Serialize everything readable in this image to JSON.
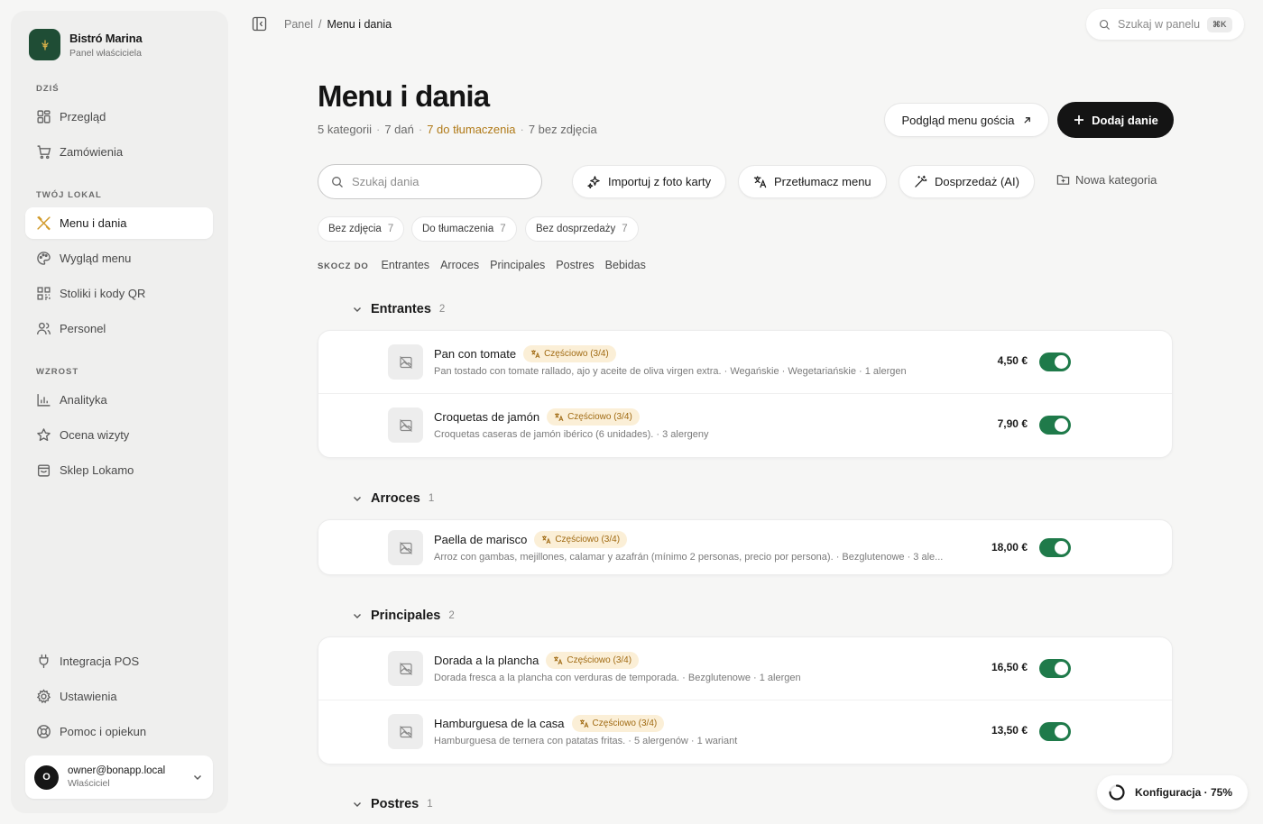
{
  "brand": {
    "name": "Bistró Marina",
    "subtitle": "Panel właściciela"
  },
  "sidebar": {
    "sections": {
      "today": "DZIŚ",
      "venue": "TWÓJ LOKAL",
      "growth": "WZROST"
    },
    "items": [
      {
        "label": "Przegląd",
        "icon": "grid-icon"
      },
      {
        "label": "Zamówienia",
        "icon": "cart-icon"
      },
      {
        "label": "Menu i dania",
        "icon": "utensils-icon",
        "active": true
      },
      {
        "label": "Wygląd menu",
        "icon": "palette-icon"
      },
      {
        "label": "Stoliki i kody QR",
        "icon": "qr-icon"
      },
      {
        "label": "Personel",
        "icon": "users-icon"
      },
      {
        "label": "Analityka",
        "icon": "chart-icon"
      },
      {
        "label": "Ocena wizyty",
        "icon": "star-icon"
      },
      {
        "label": "Sklep Lokamo",
        "icon": "shop-icon"
      },
      {
        "label": "Integracja POS",
        "icon": "plug-icon"
      },
      {
        "label": "Ustawienia",
        "icon": "gear-icon"
      },
      {
        "label": "Pomoc i opiekun",
        "icon": "lifebuoy-icon"
      }
    ]
  },
  "user": {
    "initial": "O",
    "email": "owner@bonapp.local",
    "role": "Właściciel"
  },
  "breadcrumb": {
    "root": "Panel",
    "sep": "/",
    "current": "Menu i dania"
  },
  "topsearch": {
    "placeholder": "Szukaj w panelu",
    "shortcut": "⌘K"
  },
  "header": {
    "title": "Menu i dania",
    "stats": {
      "categories": "5 kategorii",
      "dishes": "7 dań",
      "to_translate": "7 do tłumaczenia",
      "no_photo": "7 bez zdjęcia"
    },
    "preview_btn": "Podgląd menu gościa",
    "add_btn": "Dodaj danie"
  },
  "toolbar": {
    "search_placeholder": "Szukaj dania",
    "import": "Importuj z foto karty",
    "translate": "Przetłumacz menu",
    "upsell": "Dosprzedaż (AI)",
    "new_category": "Nowa kategoria"
  },
  "filters": [
    {
      "label": "Bez zdjęcia",
      "count": "7"
    },
    {
      "label": "Do tłumaczenia",
      "count": "7"
    },
    {
      "label": "Bez dosprzedaży",
      "count": "7"
    }
  ],
  "jump": {
    "label": "SKOCZ DO",
    "links": [
      "Entrantes",
      "Arroces",
      "Principales",
      "Postres",
      "Bebidas"
    ]
  },
  "categories": [
    {
      "name": "Entrantes",
      "count": "2",
      "dishes": [
        {
          "name": "Pan con tomate",
          "badge": "Częściowo (3/4)",
          "desc": "Pan tostado con tomate rallado, ajo y aceite de oliva virgen extra. · Wegańskie · Wegetariańskie · 1 alergen",
          "price": "4,50 €"
        },
        {
          "name": "Croquetas de jamón",
          "badge": "Częściowo (3/4)",
          "desc": "Croquetas caseras de jamón ibérico (6 unidades). · 3 alergeny",
          "price": "7,90 €"
        }
      ]
    },
    {
      "name": "Arroces",
      "count": "1",
      "dishes": [
        {
          "name": "Paella de marisco",
          "badge": "Częściowo (3/4)",
          "desc": "Arroz con gambas, mejillones, calamar y azafrán (mínimo 2 personas, precio por persona). · Bezglutenowe · 3 ale...",
          "price": "18,00 €"
        }
      ]
    },
    {
      "name": "Principales",
      "count": "2",
      "dishes": [
        {
          "name": "Dorada a la plancha",
          "badge": "Częściowo (3/4)",
          "desc": "Dorada fresca a la plancha con verduras de temporada. · Bezglutenowe · 1 alergen",
          "price": "16,50 €"
        },
        {
          "name": "Hamburguesa de la casa",
          "badge": "Częściowo (3/4)",
          "desc": "Hamburguesa de ternera con patatas fritas. · 5 alergenów · 1 wariant",
          "price": "13,50 €"
        }
      ]
    },
    {
      "name": "Postres",
      "count": "1",
      "dishes": []
    }
  ],
  "config": {
    "label": "Konfiguracja · 75%",
    "progress": 0.75
  },
  "colors": {
    "brand": "#1f4d35",
    "accent_warn": "#b07a18",
    "toggle_on": "#1f7a4a"
  }
}
